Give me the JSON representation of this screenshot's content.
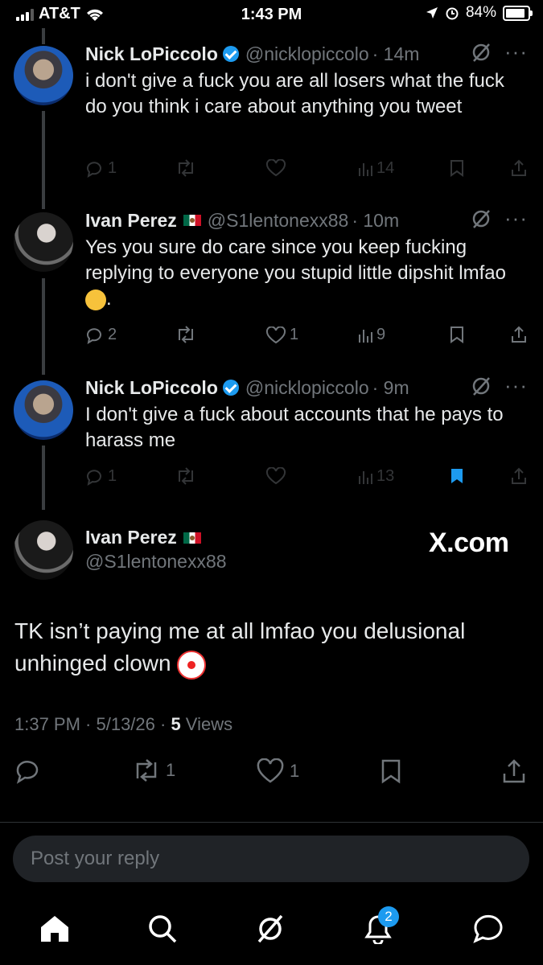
{
  "status_bar": {
    "carrier": "AT&T",
    "time": "1:43 PM",
    "battery": "84%"
  },
  "tweets": [
    {
      "name": "Nick LoPiccolo",
      "handle": "@nicklopiccolo",
      "time": "· 14m",
      "text": "i don't give a fuck you are all losers what the fuck do you think i care about anything you tweet",
      "replies": "1",
      "retweets": "",
      "likes": "",
      "views": "14"
    },
    {
      "name": "Ivan Perez",
      "handle": "@S1lentonexx88",
      "time": "· 10m",
      "text": "Yes you sure do care since you keep fucking replying to everyone you stupid little dipshit lmfao",
      "text_suffix": ".",
      "replies": "2",
      "retweets": "",
      "likes": "1",
      "views": "9"
    },
    {
      "name": "Nick LoPiccolo",
      "handle": "@nicklopiccolo",
      "time": "· 9m",
      "text": "I don't give a fuck about accounts that he pays to harass me",
      "replies": "1",
      "retweets": "",
      "likes": "",
      "views": "13"
    }
  ],
  "main_tweet": {
    "name": "Ivan Perez",
    "handle": "@S1lentonexx88",
    "watermark": "X.com",
    "text": "TK isn’t paying me at all lmfao you delusional unhinged clown",
    "timestamp": "1:37 PM · 5/13/26 · ",
    "views_count": "5",
    "views_label": " Views",
    "retweets": "1",
    "likes": "1"
  },
  "reply": {
    "placeholder": "Post your reply"
  },
  "tabs": {
    "notifications_badge": "2"
  },
  "colors": {
    "accent": "#1d9bf0",
    "muted": "#71767b",
    "text": "#e7e9ea"
  }
}
